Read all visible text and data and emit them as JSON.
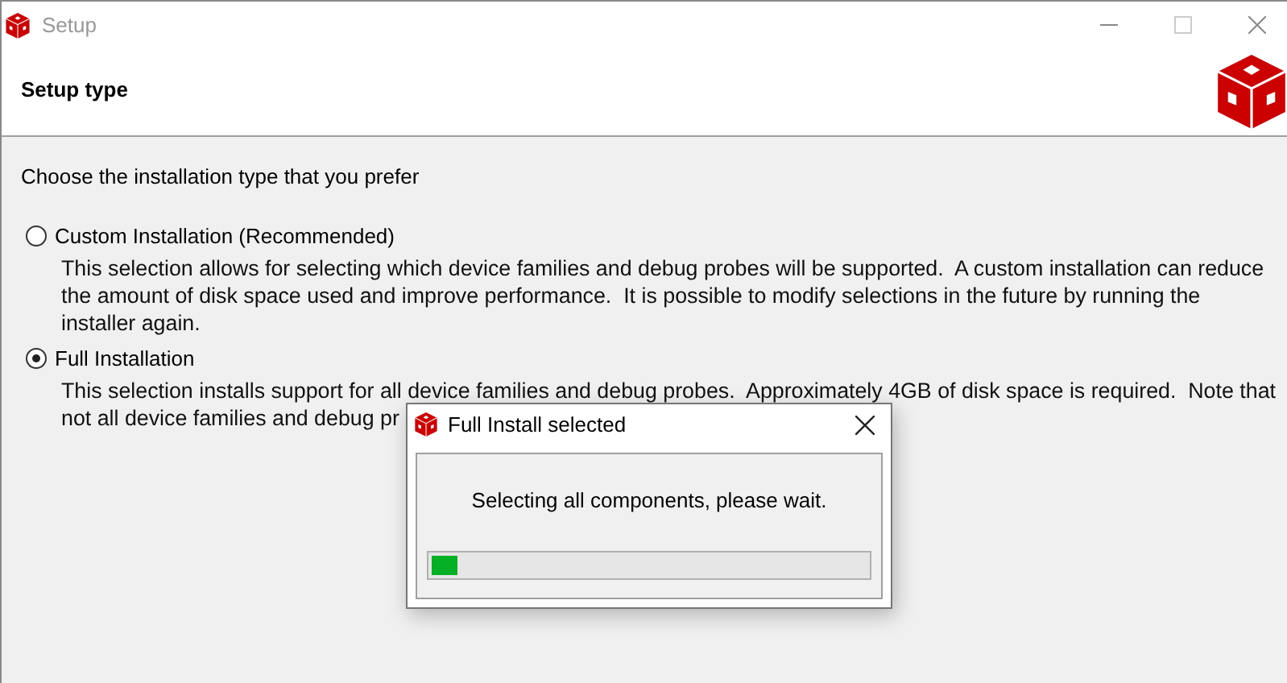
{
  "window": {
    "title": "Setup"
  },
  "header": {
    "title": "Setup type"
  },
  "prompt": "Choose the installation type that you prefer",
  "options": [
    {
      "label": "Custom Installation (Recommended)",
      "selected": false,
      "description_lines": [
        "This selection allows for selecting which device families and debug probes will be supported.  A custom installation can reduce",
        "the amount of disk space used and improve performance.  It is possible to modify selections in the future by running the",
        "installer again."
      ]
    },
    {
      "label": "Full Installation",
      "selected": true,
      "description_lines": [
        "This selection installs support for all device families and debug probes.  Approximately 4GB of disk space is required.  Note that",
        "not all device families and debug pr"
      ]
    }
  ],
  "dialog": {
    "title": "Full Install selected",
    "message": "Selecting all components, please wait.",
    "progress": {
      "level": 0.06
    }
  }
}
